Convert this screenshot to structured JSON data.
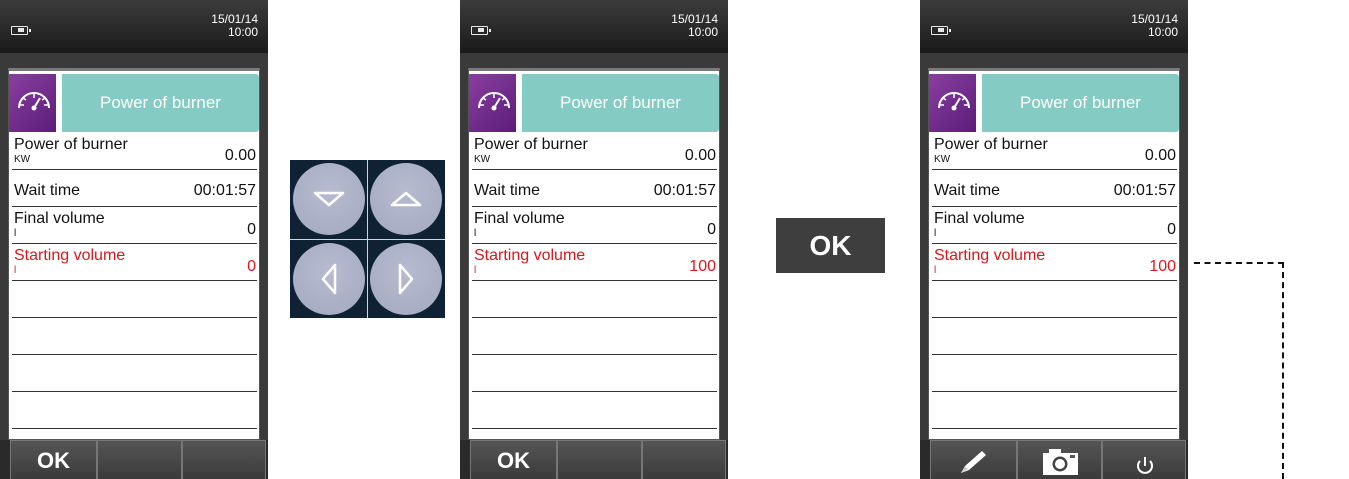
{
  "devices": [
    {
      "date": "15/01/14",
      "time": "10:00",
      "header_title": "Power of burner",
      "rows": [
        {
          "label": "Power of burner",
          "unit": "KW",
          "value": "0.00"
        },
        {
          "label": "Wait time",
          "unit": "",
          "value": "00:01:57"
        },
        {
          "label": "Final volume",
          "unit": "l",
          "value": "0"
        },
        {
          "label": "Starting volume",
          "unit": "l",
          "value": "0"
        }
      ],
      "softkeys": [
        "OK",
        "",
        ""
      ]
    },
    {
      "date": "15/01/14",
      "time": "10:00",
      "header_title": "Power of burner",
      "rows": [
        {
          "label": "Power of burner",
          "unit": "KW",
          "value": "0.00"
        },
        {
          "label": "Wait time",
          "unit": "",
          "value": "00:01:57"
        },
        {
          "label": "Final volume",
          "unit": "l",
          "value": "0"
        },
        {
          "label": "Starting volume",
          "unit": "l",
          "value": "100"
        }
      ],
      "softkeys": [
        "OK",
        "",
        ""
      ]
    },
    {
      "date": "15/01/14",
      "time": "10:00",
      "header_title": "Power of burner",
      "rows": [
        {
          "label": "Power of burner",
          "unit": "KW",
          "value": "0.00"
        },
        {
          "label": "Wait time",
          "unit": "",
          "value": "00:01:57"
        },
        {
          "label": "Final volume",
          "unit": "l",
          "value": "0"
        },
        {
          "label": "Starting volume",
          "unit": "l",
          "value": "100"
        }
      ],
      "softkey_icons": [
        "pencil-icon",
        "camera-icon",
        "power-icon"
      ]
    }
  ],
  "nav_pad": {
    "icons": [
      "arrow-down-icon",
      "arrow-up-icon",
      "arrow-left-icon",
      "arrow-right-icon"
    ]
  },
  "ok_key_label": "OK",
  "colors": {
    "header_teal": "#84ccc3",
    "icon_purple": "#6a2a8a",
    "active_red": "#e0161b",
    "nav_pad_bg": "#0f2233",
    "nav_button": "#aeb2c8"
  }
}
